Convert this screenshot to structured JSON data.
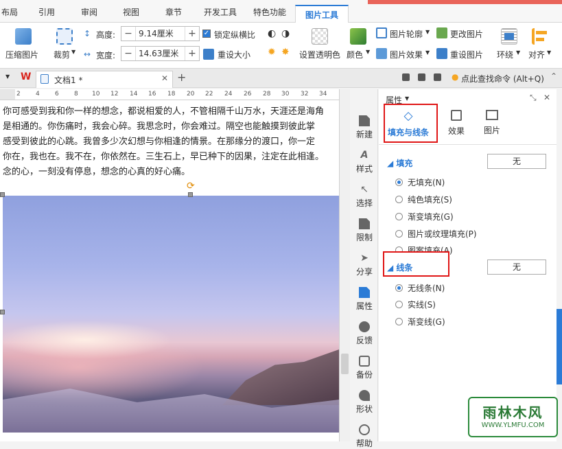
{
  "tabs": [
    {
      "label": "布局",
      "active": false
    },
    {
      "label": "引用",
      "active": false
    },
    {
      "label": "审阅",
      "active": false
    },
    {
      "label": "视图",
      "active": false
    },
    {
      "label": "章节",
      "active": false
    },
    {
      "label": "开发工具",
      "active": false
    },
    {
      "label": "特色功能",
      "active": false
    },
    {
      "label": "图片工具",
      "active": true
    }
  ],
  "ribbon": {
    "compress": "压缩图片",
    "crop": "裁剪",
    "height_label": "高度:",
    "height_value": "9.14厘米",
    "width_label": "宽度:",
    "width_value": "14.63厘米",
    "lock_ratio": "锁定纵横比",
    "reset_size": "重设大小",
    "transparent": "设置透明色",
    "color": "颜色",
    "outline": "图片轮廓",
    "effects": "图片效果",
    "change_picture": "更改图片",
    "reset_picture": "重设图片",
    "wrap": "环绕",
    "align": "对齐",
    "minus": "−",
    "plus": "+"
  },
  "docbar": {
    "doc_title": "文档1 *",
    "search_cmd": "点此查找命令 (Alt+Q)"
  },
  "ruler_ticks": [
    "2",
    "4",
    "6",
    "8",
    "10",
    "12",
    "14",
    "16",
    "18",
    "20",
    "22",
    "24",
    "26",
    "28",
    "30",
    "32",
    "34"
  ],
  "document": {
    "lines": "你可感受到我和你一样的想念，都说相爱的人，不管相隔千山万水，天涯还是海角\n是相通的。你伤痛时，我会心碎。我思念时，你会难过。隔空也能触摸到彼此掌\n感受到彼此的心跳。我曾多少次幻想与你相逢的情景。在那缘分的渡口，你一定\n你在，我也在。我不在，你依然在。三生石上，早已种下的因果，注定在此相逢。\n念的心，一刻没有停息，想念的心真的好心痛。"
  },
  "sidebar": [
    {
      "label": "新建",
      "icon": "new-icon"
    },
    {
      "label": "样式",
      "icon": "style-icon"
    },
    {
      "label": "选择",
      "icon": "select-icon"
    },
    {
      "label": "限制",
      "icon": "restrict-icon"
    },
    {
      "label": "分享",
      "icon": "share-icon"
    },
    {
      "label": "属性",
      "icon": "property-icon"
    },
    {
      "label": "反馈",
      "icon": "feedback-icon"
    },
    {
      "label": "备份",
      "icon": "backup-icon"
    },
    {
      "label": "形状",
      "icon": "shape-icon"
    },
    {
      "label": "帮助",
      "icon": "help-icon"
    }
  ],
  "panel": {
    "title": "属性",
    "tabs": [
      "填充与线条",
      "效果",
      "图片"
    ],
    "fill_section": "填充",
    "fill_value": "无",
    "fill_options": [
      "无填充(N)",
      "纯色填充(S)",
      "渐变填充(G)",
      "图片或纹理填充(P)",
      "图案填充(A)"
    ],
    "line_section": "线条",
    "line_value": "无",
    "line_options": [
      "无线条(N)",
      "实线(S)",
      "渐变线(G)"
    ]
  },
  "watermark": {
    "title": "雨林木风",
    "url": "WWW.YLMFU.COM"
  }
}
